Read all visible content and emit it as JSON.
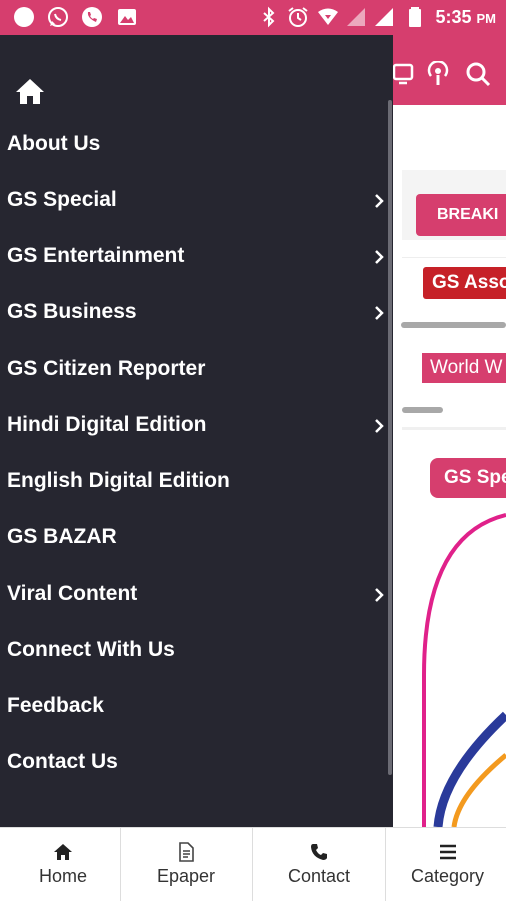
{
  "status_bar": {
    "time": "5:35",
    "ampm": "PM",
    "left_icons": [
      "circle-icon",
      "whatsapp-icon",
      "phone-icon",
      "image-icon"
    ],
    "right_icons": [
      "bluetooth-icon",
      "alarm-icon",
      "wifi-icon",
      "signal-icon",
      "battery-icon"
    ]
  },
  "drawer": {
    "home_icon": "home-icon",
    "items": [
      {
        "label": "About Us",
        "has_submenu": false
      },
      {
        "label": "GS Special",
        "has_submenu": true
      },
      {
        "label": "GS Entertainment",
        "has_submenu": true
      },
      {
        "label": "GS Business",
        "has_submenu": true
      },
      {
        "label": "GS Citizen Reporter",
        "has_submenu": false
      },
      {
        "label": "Hindi Digital Edition",
        "has_submenu": true
      },
      {
        "label": "English Digital Edition",
        "has_submenu": false
      },
      {
        "label": "GS BAZAR",
        "has_submenu": false
      },
      {
        "label": "Viral Content",
        "has_submenu": true
      },
      {
        "label": "Connect With Us",
        "has_submenu": false
      },
      {
        "label": "Feedback",
        "has_submenu": false
      },
      {
        "label": "Contact Us",
        "has_submenu": false
      }
    ]
  },
  "background": {
    "breaking_label": "BREAKI",
    "pill_1": "GS Asso",
    "pill_2": "World W",
    "pill_3": "GS Spe"
  },
  "bottom_nav": {
    "tabs": [
      {
        "label": "Home",
        "icon": "home-icon"
      },
      {
        "label": "Epaper",
        "icon": "document-icon"
      },
      {
        "label": "Contact",
        "icon": "phone-icon"
      },
      {
        "label": "Category",
        "icon": "menu-icon"
      }
    ]
  },
  "colors": {
    "brand": "#d63e6e",
    "drawer_bg": "#262630",
    "breaking_red": "#c62128"
  }
}
